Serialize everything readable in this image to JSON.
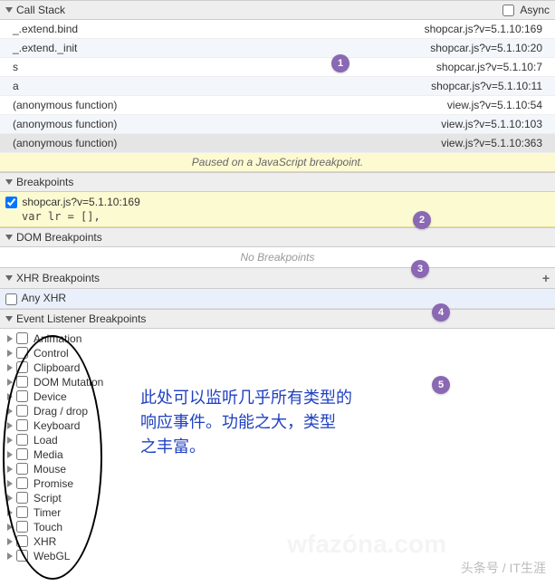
{
  "call_stack": {
    "title": "Call Stack",
    "async_label": "Async",
    "rows": [
      {
        "fn": "_.extend.bind",
        "loc": "shopcar.js?v=5.1.10:169",
        "alt": false
      },
      {
        "fn": "_.extend._init",
        "loc": "shopcar.js?v=5.1.10:20",
        "alt": true
      },
      {
        "fn": "s",
        "loc": "shopcar.js?v=5.1.10:7",
        "alt": false
      },
      {
        "fn": "a",
        "loc": "shopcar.js?v=5.1.10:11",
        "alt": true
      },
      {
        "fn": "(anonymous function)",
        "loc": "view.js?v=5.1.10:54",
        "alt": false
      },
      {
        "fn": "(anonymous function)",
        "loc": "view.js?v=5.1.10:103",
        "alt": true
      },
      {
        "fn": "(anonymous function)",
        "loc": "view.js?v=5.1.10:363",
        "alt": false,
        "highlight": true
      }
    ],
    "paused_text": "Paused on a JavaScript breakpoint."
  },
  "breakpoints": {
    "title": "Breakpoints",
    "item_file": "shopcar.js?v=5.1.10:169",
    "item_code": "var lr = [],"
  },
  "dom_bp": {
    "title": "DOM Breakpoints",
    "empty": "No Breakpoints"
  },
  "xhr_bp": {
    "title": "XHR Breakpoints",
    "any_label": "Any XHR"
  },
  "event_bp": {
    "title": "Event Listener Breakpoints",
    "items": [
      "Animation",
      "Control",
      "Clipboard",
      "DOM Mutation",
      "Device",
      "Drag / drop",
      "Keyboard",
      "Load",
      "Media",
      "Mouse",
      "Promise",
      "Script",
      "Timer",
      "Touch",
      "XHR",
      "WebGL"
    ]
  },
  "bullets": {
    "b1": "1",
    "b2": "2",
    "b3": "3",
    "b4": "4",
    "b5": "5"
  },
  "annotation_line1": "此处可以监听几乎所有类型的",
  "annotation_line2": "响应事件。功能之大，类型",
  "annotation_line3": "之丰富。",
  "wm1": "头条号 / IT生涯",
  "wm2": "wfazóna.com"
}
